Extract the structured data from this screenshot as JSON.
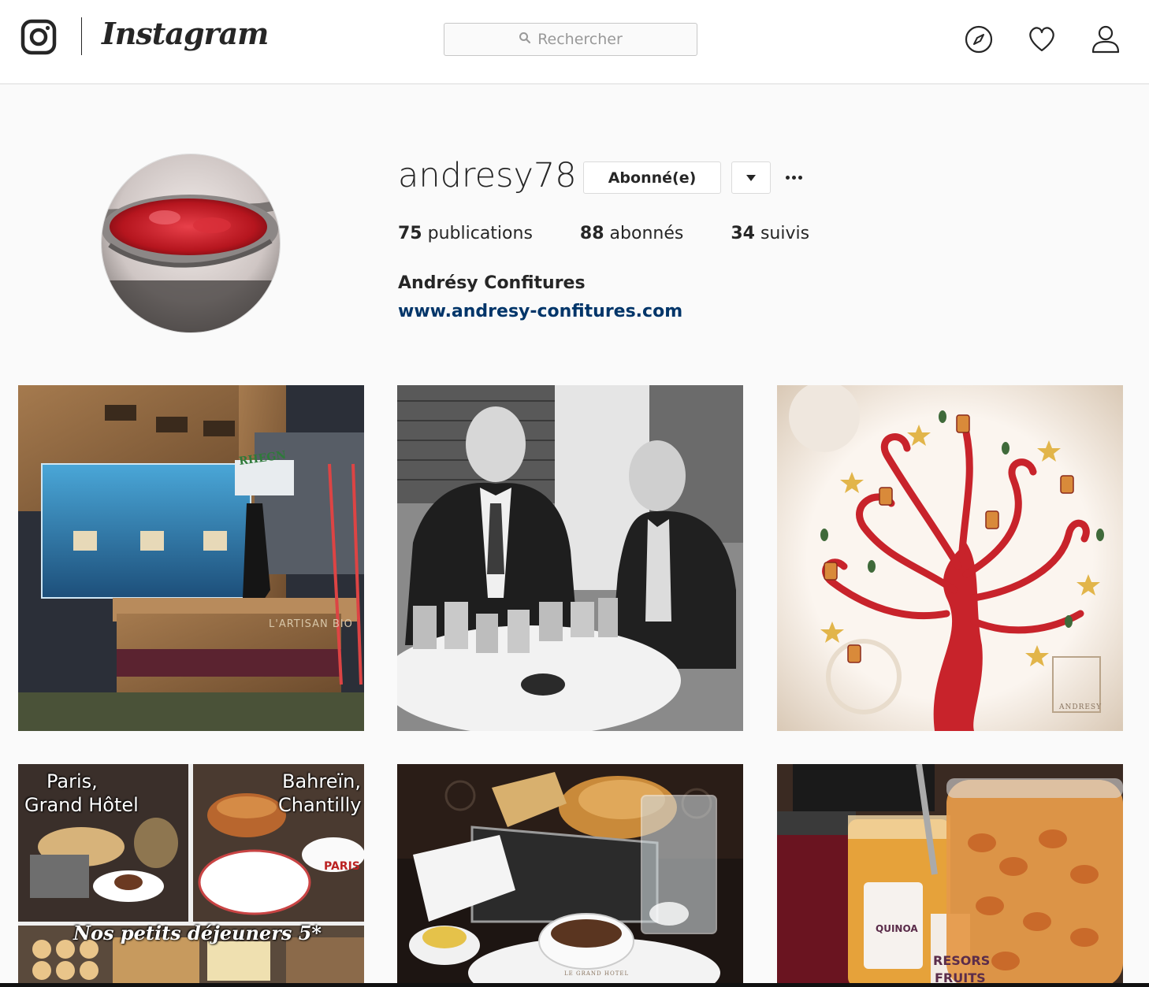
{
  "nav": {
    "brand_name": "Instagram",
    "search_placeholder": "Rechercher"
  },
  "profile": {
    "username": "andresy78",
    "follow_button_label": "Abonné(e)",
    "stats": {
      "posts_count": "75",
      "posts_label": "publications",
      "followers_count": "88",
      "followers_label": "abonnés",
      "following_count": "34",
      "following_label": "suivis"
    },
    "full_name": "Andrésy Confitures",
    "website": "www.andresy-confitures.com"
  },
  "posts": [
    {
      "photo_texts": [
        "RHEGN",
        "L'ARTISAN BIO"
      ]
    },
    {
      "photo_texts": []
    },
    {
      "photo_texts": [
        "ANDRESY"
      ]
    },
    {
      "photo_texts": [
        "Paris,",
        "Grand Hôtel",
        "Bahreïn,",
        "Chantilly",
        "PARIS",
        "Nos petits déjeuners 5*"
      ]
    },
    {
      "photo_texts": [
        "LE GRAND HOTEL"
      ]
    },
    {
      "photo_texts": [
        "QUINOA",
        "RESORS",
        "FRUITS"
      ]
    }
  ],
  "colors": {
    "link": "#003569",
    "border": "#dbdbdb",
    "background": "#fafafa"
  }
}
